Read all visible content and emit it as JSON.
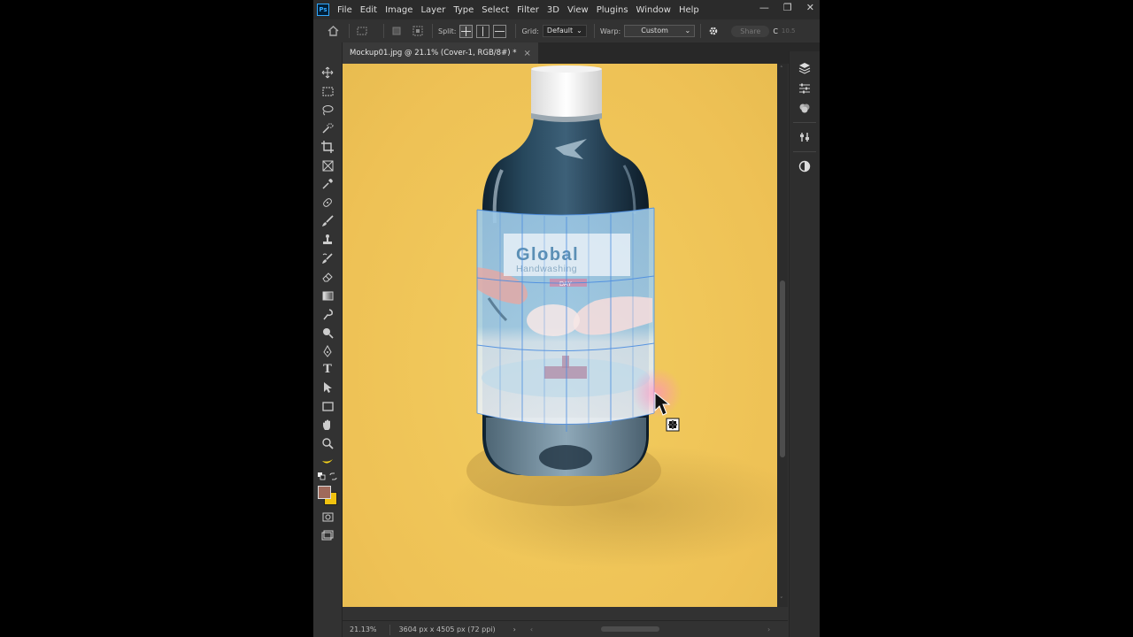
{
  "app": {
    "logo": "Ps"
  },
  "menu": [
    "File",
    "Edit",
    "Image",
    "Layer",
    "Type",
    "Select",
    "Filter",
    "3D",
    "View",
    "Plugins",
    "Window",
    "Help"
  ],
  "window_controls": {
    "minimize": "—",
    "restore": "❐",
    "close": "✕"
  },
  "options_bar": {
    "split_label": "Split:",
    "grid_label": "Grid:",
    "grid_value": "Default",
    "warp_label": "Warp:",
    "warp_value": "Custom",
    "share_label": "Share",
    "right_value": "10.5"
  },
  "document": {
    "tab_title": "Mockup01.jpg @ 21.1% (Cover-1, RGB/8#) *",
    "close": "×"
  },
  "label": {
    "title": "Global",
    "subtitle": "Handwashing",
    "badge": "DAY"
  },
  "colors": {
    "foreground": "#9f6a5b",
    "background": "#f0c20f",
    "canvas_background": "#f0c75a"
  },
  "status": {
    "zoom": "21.13%",
    "doc_size": "3604 px x 4505 px (72 ppi)"
  }
}
